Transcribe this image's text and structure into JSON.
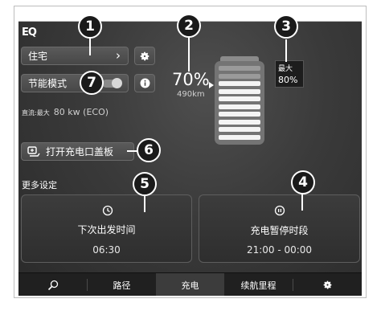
{
  "brand": "EQ",
  "location": {
    "label": "住宅",
    "chevron": "›"
  },
  "eco": {
    "label": "节能模式"
  },
  "dc_info": {
    "prefix": "直流:最大",
    "value": "80 kw (ECO)"
  },
  "charge": {
    "percent": "70%",
    "range": "490km"
  },
  "max_charge": {
    "label": "最大",
    "value": "80%"
  },
  "open_flap": {
    "label": "打开充电口盖板"
  },
  "more_settings": "更多设定",
  "departure": {
    "label": "下次出发时间",
    "time": "06:30"
  },
  "pause": {
    "label": "充电暂停时段",
    "time": "21:00 - 00:00"
  },
  "nav": {
    "route": "路径",
    "charge": "充电",
    "range": "续航里程"
  },
  "callouts": [
    "1",
    "2",
    "3",
    "4",
    "5",
    "6",
    "7"
  ],
  "colors": {
    "screen_bg": "#3a3a3a",
    "callout_bg": "#1a1a1a",
    "nav_bg": "#202020"
  }
}
